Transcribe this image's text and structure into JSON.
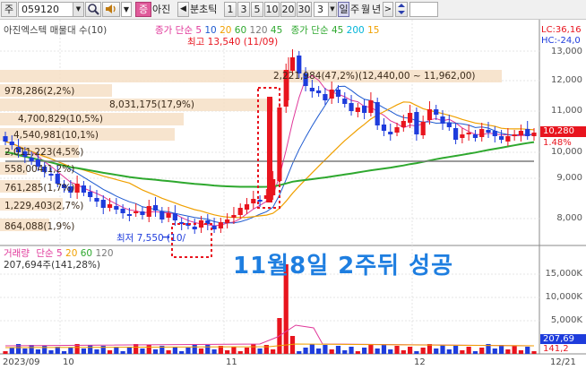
{
  "toolbar": {
    "market": "주",
    "code": "059120",
    "search_icon": "magnifier-icon",
    "speaker_icon": "speaker-icon",
    "badge": "증",
    "stock_short": "아진",
    "prev_arrow": "◀",
    "period_label": "분초틱",
    "intervals": [
      "1",
      "3",
      "5",
      "10",
      "20",
      "30"
    ],
    "interval_value": "3",
    "day": "일",
    "week": "주",
    "month": "월",
    "year": "년",
    "next_arrow": ">",
    "updown_icon": "updown-arrows-icon"
  },
  "price_panel": {
    "title": "아진엑스텍 매물대 수(10)",
    "ma_label": "종가 단순",
    "ma_periods": [
      "5",
      "10",
      "20",
      "60",
      "120",
      "45"
    ],
    "ma_label2": "종가 단순",
    "ma_periods2": [
      "45",
      "200",
      "15"
    ],
    "lc": "LC:36,16",
    "hc": "HC:-24,0",
    "current_price": "10,280",
    "current_pct": "1.48%",
    "high_label": "최고 13,540 (11/09)",
    "low_label": "최저 7,550 (10/",
    "low_arrow": "→",
    "volume_profile": [
      "2,221,984(47,2%)(12,440,00 ~ 11,962,00)",
      "978,286(2,2%)",
      "8,031,175(17,9%)",
      "4,700,829(10,5%)",
      "4,540,981(10,1%)",
      "2,011,223(4,5%)",
      "558,004(1,2%)",
      "761,285(1,7%)",
      "1,229,403(2,7%)",
      "864,088(1,9%)"
    ],
    "price_axis": [
      "13,000",
      "12,000",
      "11,000",
      "10,000",
      "9,000",
      "8,000"
    ]
  },
  "volume_panel": {
    "title": "거래량",
    "ma_label": "단순",
    "ma_periods": [
      "5",
      "20",
      "60",
      "120"
    ],
    "volume_value": "207,694주(141,28%)",
    "axis": [
      "15,000K",
      "10,000K",
      "5,000K"
    ],
    "current_volume": "207,69",
    "current_volume_pct": "141,2"
  },
  "dates": [
    "2023/09",
    "10",
    "11",
    "12",
    "12/21"
  ],
  "annotation": "11월8일 2주뒤 성공",
  "colors": {
    "up": "#e8141e",
    "down": "#1e3cdc",
    "band": "#f6dfc6",
    "ma5": "#e0389a",
    "ma10": "#1e5ad0",
    "ma20": "#f0a000",
    "ma60": "#2ea82e",
    "ma120": "#7a7a7a",
    "annotation": "#1e7ee0"
  }
}
